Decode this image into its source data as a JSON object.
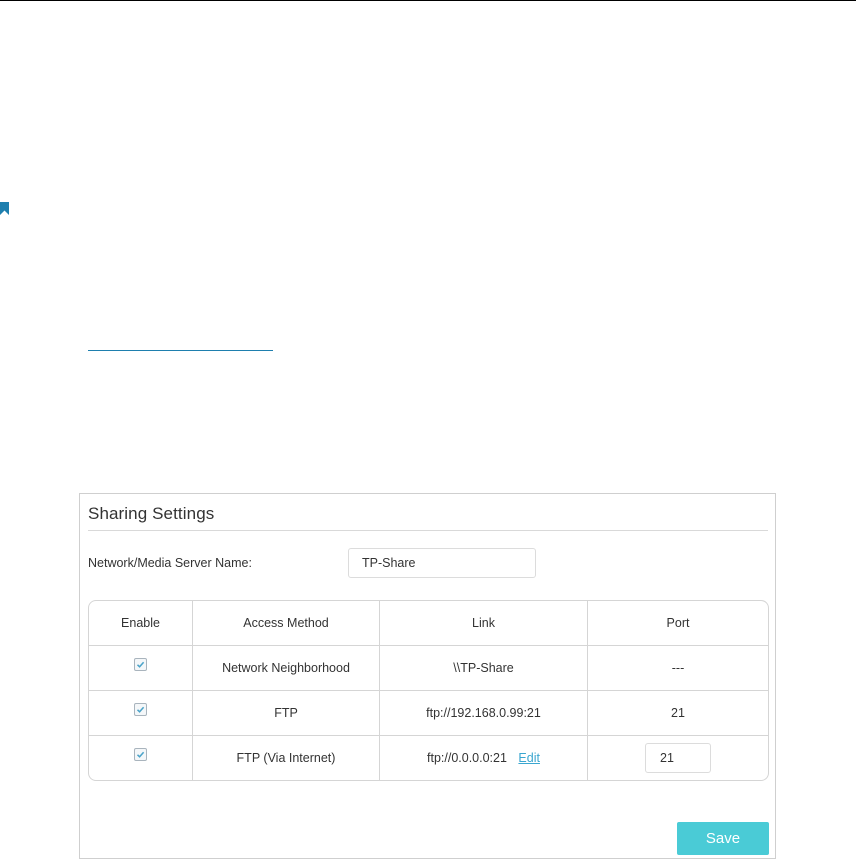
{
  "colors": {
    "accent": "#4acbd6",
    "link": "#3aa6d0",
    "bookmark": "#1e7fae"
  },
  "icons": {
    "bookmark": "bookmark-icon",
    "checkbox": "checkbox-checked-icon"
  },
  "panel": {
    "title": "Sharing Settings",
    "server_name_label": "Network/Media Server Name:",
    "server_name_value": "TP-Share",
    "table": {
      "headers": [
        "Enable",
        "Access Method",
        "Link",
        "Port"
      ],
      "rows": [
        {
          "enabled": true,
          "method": "Network Neighborhood",
          "link": "\\\\TP-Share",
          "port": "---"
        },
        {
          "enabled": true,
          "method": "FTP",
          "link": "ftp://192.168.0.99:21",
          "port": "21"
        },
        {
          "enabled": true,
          "method": "FTP (Via Internet)",
          "link": "ftp://0.0.0.0:21",
          "edit_label": "Edit",
          "port": "21"
        }
      ]
    },
    "save_label": "Save"
  }
}
